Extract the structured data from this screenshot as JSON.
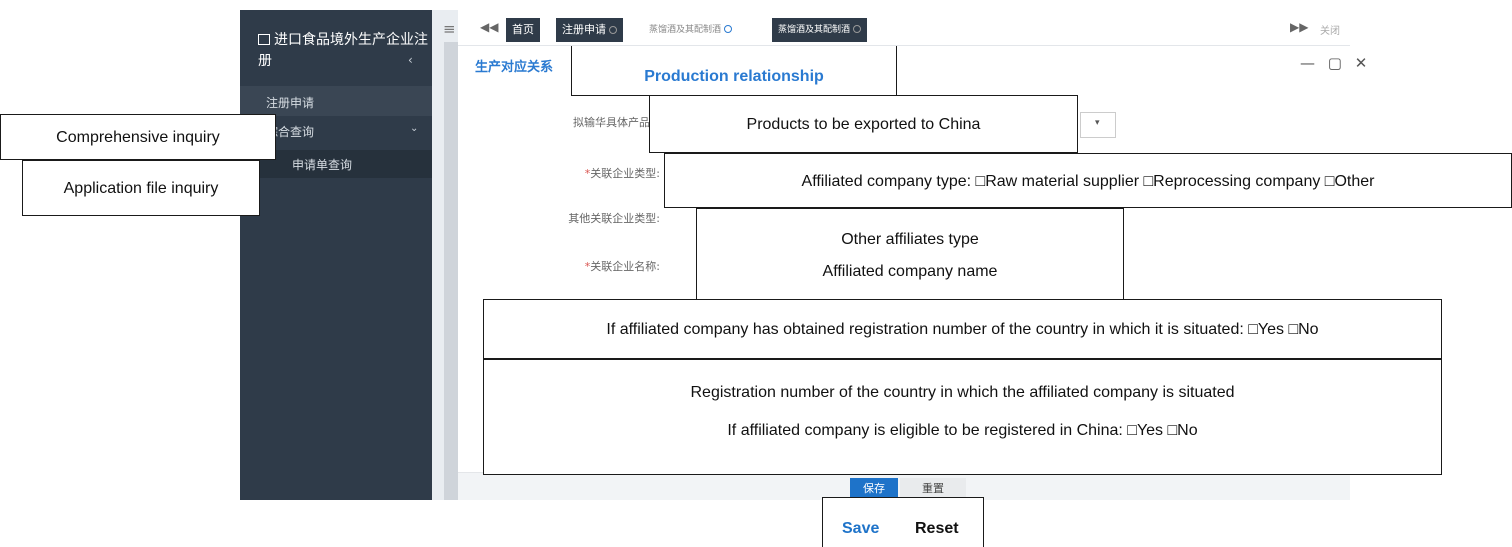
{
  "app": {
    "title": "进口食品境外生产企业注册",
    "collapse_glyph": "‹"
  },
  "sidebar": {
    "items": [
      {
        "label": "注册申请"
      },
      {
        "label": "综合查询",
        "chevron": "⌄"
      },
      {
        "label": "申请单查询"
      }
    ]
  },
  "tabs": {
    "menu_icon": "≡",
    "prev_icon": "◀◀",
    "next_icon": "▶▶",
    "close_label": "关闭",
    "items": [
      {
        "label": "首页",
        "active": true
      },
      {
        "label": "注册申请",
        "active": false
      },
      {
        "label": "蒸馏酒及其配制酒",
        "active": false
      },
      {
        "label": "蒸馏酒及其配制酒",
        "active": true
      }
    ]
  },
  "panel": {
    "title": "生产对应关系",
    "window_controls": "— ▢ ✕"
  },
  "form": {
    "labels": {
      "products": "拟输华具体产品",
      "affiliate_type": "关联企业类型:",
      "other_type": "其他关联企业类型:",
      "affiliate_name": "关联企业名称:"
    },
    "select_arrow": "▾"
  },
  "buttons": {
    "save": "保存",
    "reset": "重置"
  },
  "annotations": {
    "production_relationship": "Production relationship",
    "products_to_china": "Products to be exported to China",
    "affiliate_type": "Affiliated company type: □Raw material supplier □Reprocessing company □Other",
    "other_affiliates_type": "Other affiliates type",
    "affiliated_company_name": "Affiliated company name",
    "registration_obtained": "If affiliated company has obtained registration number of the country in which it is situated: □Yes □No",
    "registration_number": "Registration number of the country in which the affiliated company is situated",
    "eligible_china": "If affiliated company is eligible to be registered in China: □Yes □No",
    "comprehensive_inquiry": "Comprehensive inquiry",
    "application_file_inquiry": "Application file inquiry",
    "save": "Save",
    "reset": "Reset"
  },
  "colors": {
    "sidebar": "#2f3b49",
    "accent": "#2a7ad1",
    "save_button": "#1e73c9",
    "required": "#d9534f"
  }
}
